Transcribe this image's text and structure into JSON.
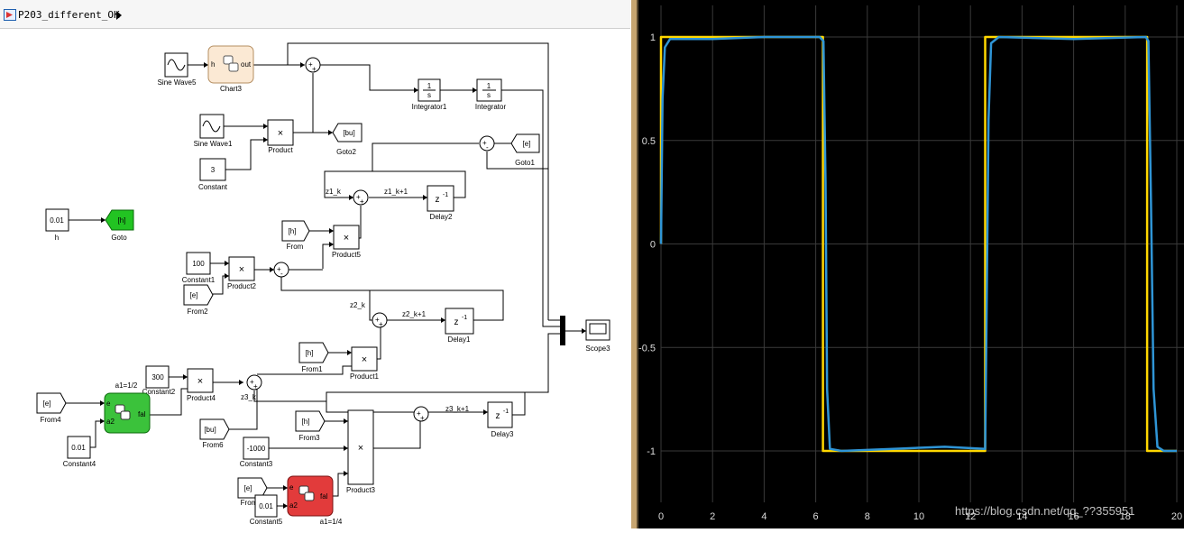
{
  "breadcrumb": {
    "model": "P203_different_OK"
  },
  "blocks": {
    "sine_wave5": "Sine Wave5",
    "chart3": "Chart3",
    "chart3_in": "h",
    "chart3_out": "out",
    "sine_wave1": "Sine Wave1",
    "constant_val": "3",
    "constant": "Constant",
    "product": "Product",
    "goto2_tag": "[bu]",
    "goto2": "Goto2",
    "integrator1": "Integrator1",
    "integrator": "Integrator",
    "int_num": "1",
    "int_den": "s",
    "goto1_tag": "[e]",
    "goto1": "Goto1",
    "h_val": "0.01",
    "h": "h",
    "goto_tag": "[h]",
    "goto": "Goto",
    "z1_k": "z1_k",
    "z1_k1": "z1_k+1",
    "delay2": "Delay2",
    "delay_z": "z",
    "delay_exp": "-1",
    "from_tag": "[h]",
    "from": "From",
    "product5": "Product5",
    "constant1_val": "100",
    "constant1": "Constant1",
    "product2": "Product2",
    "from2_tag": "[e]",
    "from2": "From2",
    "z2_k": "z2_k",
    "z2_k1": "z2_k+1",
    "delay1": "Delay1",
    "from1_tag": "[h]",
    "from1": "From1",
    "product1": "Product1",
    "scope3": "Scope3",
    "constant2_val": "300",
    "constant2": "Constant2",
    "product4": "Product4",
    "a1_half": "a1=1/2",
    "z3_k": "z3_k",
    "z3_k1": "z3_k+1",
    "delay3": "Delay3",
    "from4_tag": "[e]",
    "from4": "From4",
    "port_e": "e",
    "port_a2": "a2",
    "port_fal": "fal",
    "from6_tag": "[bu]",
    "from6": "From6",
    "from3_tag": "[h]",
    "from3": "From3",
    "constant4_val": "0.01",
    "constant4": "Constant4",
    "constant3_val": "-1000",
    "constant3": "Constant3",
    "product3": "Product3",
    "from5_tag": "[e]",
    "from5": "From",
    "constant5_val": "0.01",
    "constant5": "Constant5",
    "a1_quarter": "a1=1/4",
    "mult": "×"
  },
  "chart_data": {
    "type": "line",
    "x_ticks": [
      "0",
      "2",
      "4",
      "6",
      "8",
      "10",
      "12",
      "14",
      "16",
      "18",
      "20"
    ],
    "y_ticks": [
      "1",
      "0.5",
      "0",
      "-0.5",
      "-1"
    ],
    "xlim": [
      0,
      20
    ],
    "ylim": [
      -1.2,
      1.2
    ],
    "grid": true,
    "colors": {
      "reference": "#ffd700",
      "tracking": "#2f95d6",
      "grid": "#3a3a3a",
      "background": "#000000"
    },
    "series": [
      {
        "color": "#ffd700",
        "points": [
          [
            0,
            0
          ],
          [
            0,
            1
          ],
          [
            6.28,
            1
          ],
          [
            6.28,
            -1
          ],
          [
            12.57,
            -1
          ],
          [
            12.57,
            1
          ],
          [
            18.85,
            1
          ],
          [
            18.85,
            -1
          ],
          [
            20,
            -1
          ]
        ]
      },
      {
        "color": "#2f95d6",
        "points": [
          [
            0,
            0
          ],
          [
            0.06,
            0.7
          ],
          [
            0.15,
            0.95
          ],
          [
            0.35,
            0.99
          ],
          [
            2,
            0.99
          ],
          [
            4,
            1
          ],
          [
            6.15,
            1
          ],
          [
            6.3,
            0.98
          ],
          [
            6.38,
            0.3
          ],
          [
            6.44,
            -0.7
          ],
          [
            6.55,
            -0.99
          ],
          [
            7,
            -1
          ],
          [
            9,
            -0.99
          ],
          [
            11,
            -0.98
          ],
          [
            12.57,
            -0.99
          ],
          [
            12.62,
            -0.4
          ],
          [
            12.7,
            0.6
          ],
          [
            12.8,
            0.97
          ],
          [
            13.1,
            1
          ],
          [
            16,
            0.99
          ],
          [
            18.8,
            1
          ],
          [
            18.9,
            0.98
          ],
          [
            19.0,
            0.2
          ],
          [
            19.1,
            -0.7
          ],
          [
            19.25,
            -0.98
          ],
          [
            19.5,
            -1
          ],
          [
            20,
            -1
          ]
        ]
      }
    ]
  },
  "watermark": "https://blog.csdn.net/qq_??355951"
}
